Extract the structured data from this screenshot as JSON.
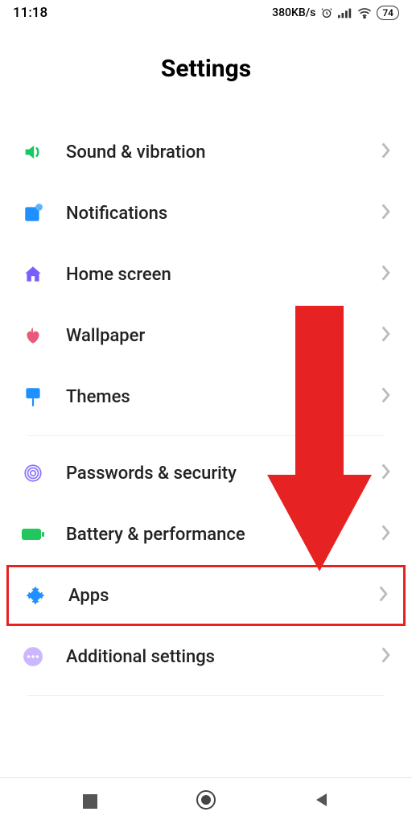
{
  "status": {
    "time": "11:18",
    "speed": "380KB/s",
    "battery": "74"
  },
  "title": "Settings",
  "sections": [
    {
      "rows": [
        {
          "icon": "sound-icon",
          "label": "Sound & vibration"
        },
        {
          "icon": "notifications-icon",
          "label": "Notifications"
        },
        {
          "icon": "home-icon",
          "label": "Home screen"
        },
        {
          "icon": "wallpaper-icon",
          "label": "Wallpaper"
        },
        {
          "icon": "themes-icon",
          "label": "Themes"
        }
      ]
    },
    {
      "rows": [
        {
          "icon": "fingerprint-icon",
          "label": "Passwords & security"
        },
        {
          "icon": "battery-icon",
          "label": "Battery & performance"
        },
        {
          "icon": "apps-icon",
          "label": "Apps",
          "highlight": true
        },
        {
          "icon": "more-icon",
          "label": "Additional settings"
        }
      ]
    }
  ],
  "colors": {
    "highlight": "#e62222",
    "arrow": "#e62222"
  }
}
